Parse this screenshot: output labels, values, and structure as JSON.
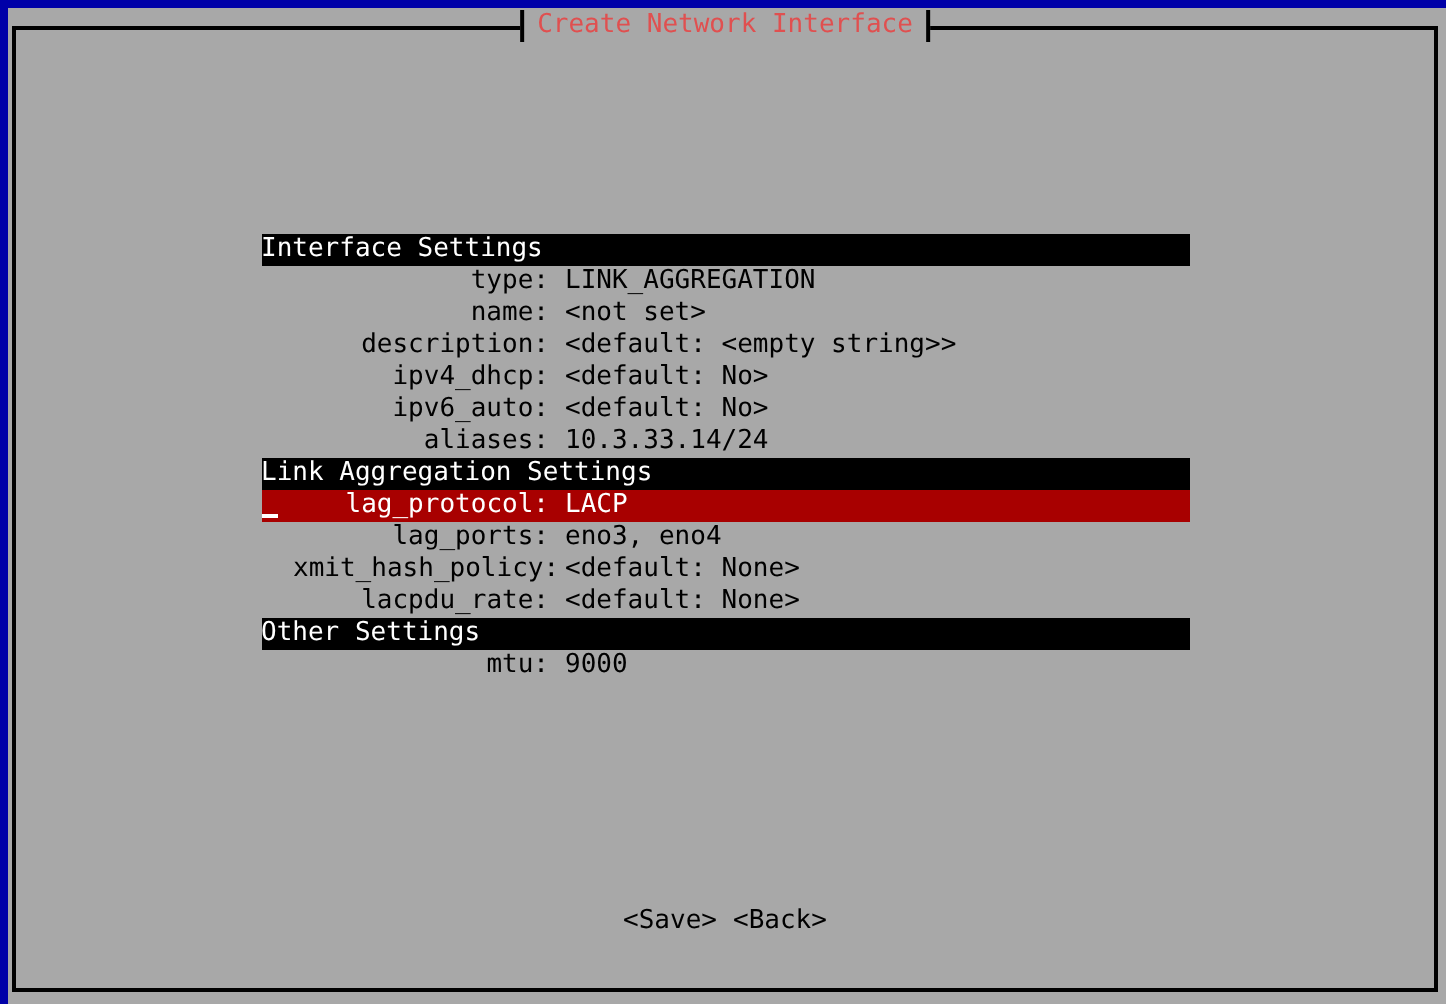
{
  "window": {
    "title": "Create Network Interface"
  },
  "sections": [
    {
      "title": "Interface Settings",
      "fields": [
        {
          "label": "type:",
          "value": "LINK_AGGREGATION",
          "selected": false
        },
        {
          "label": "name:",
          "value": "<not set>",
          "selected": false
        },
        {
          "label": "description:",
          "value": "<default: <empty string>>",
          "selected": false
        },
        {
          "label": "ipv4_dhcp:",
          "value": "<default: No>",
          "selected": false
        },
        {
          "label": "ipv6_auto:",
          "value": "<default: No>",
          "selected": false
        },
        {
          "label": "aliases:",
          "value": "10.3.33.14/24",
          "selected": false
        }
      ]
    },
    {
      "title": "Link Aggregation Settings",
      "fields": [
        {
          "label": "lag_protocol:",
          "value": "LACP",
          "selected": true
        },
        {
          "label": "lag_ports:",
          "value": "eno3, eno4",
          "selected": false
        },
        {
          "label": "xmit_hash_policy:",
          "value": "<default: None>",
          "selected": false
        },
        {
          "label": "lacpdu_rate:",
          "value": "<default: None>",
          "selected": false
        }
      ]
    },
    {
      "title": "Other Settings",
      "fields": [
        {
          "label": "mtu:",
          "value": "9000",
          "selected": false
        }
      ]
    }
  ],
  "buttons": [
    "<Save>",
    "<Back>"
  ]
}
